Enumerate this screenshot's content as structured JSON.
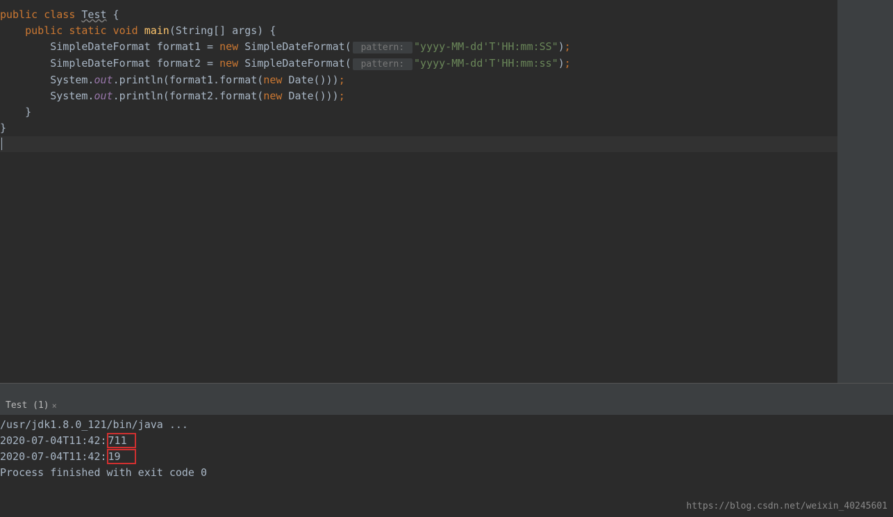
{
  "code": {
    "line1": {
      "kw_public": "public ",
      "kw_class": "class ",
      "class_name": "Test",
      "brace": " {"
    },
    "line2": {
      "indent": "    ",
      "kw_public": "public ",
      "kw_static": "static ",
      "kw_void": "void ",
      "method": "main",
      "params": "(String[] args) {"
    },
    "line3": {
      "indent": "        ",
      "type": "SimpleDateFormat format1 = ",
      "kw_new": "new ",
      "ctor": "SimpleDateFormat(",
      "hint": " pattern: ",
      "str": "\"yyyy-MM-dd'T'HH:mm:SS\"",
      "close": ")",
      "semi": ";"
    },
    "line4": {
      "indent": "        ",
      "type": "SimpleDateFormat format2 = ",
      "kw_new": "new ",
      "ctor": "SimpleDateFormat(",
      "hint": " pattern: ",
      "str": "\"yyyy-MM-dd'T'HH:mm:ss\"",
      "close": ")",
      "semi": ";"
    },
    "line5": {
      "indent": "        ",
      "sys": "System.",
      "out": "out",
      "call": ".println(format1.format(",
      "kw_new": "new ",
      "date": "Date()))",
      "semi": ";"
    },
    "line6": {
      "indent": "        ",
      "sys": "System.",
      "out": "out",
      "call": ".println(format2.format(",
      "kw_new": "new ",
      "date": "Date()))",
      "semi": ";"
    },
    "line7": "    }",
    "line8": "}"
  },
  "console": {
    "tab_label": "Test (1)",
    "close": "×",
    "line1": "/usr/jdk1.8.0_121/bin/java ...",
    "line2_prefix": "2020-07-04T11:42:",
    "line2_box": "711 ",
    "line3_prefix": "2020-07-04T11:42:",
    "line3_box": "19  ",
    "line4": "",
    "line5": "Process finished with exit code 0"
  },
  "watermark": "https://blog.csdn.net/weixin_40245601"
}
